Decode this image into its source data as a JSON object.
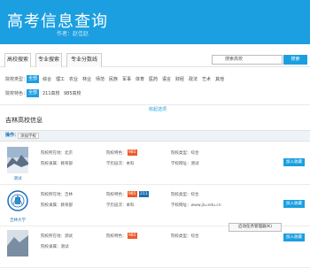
{
  "header": {
    "title": "高考信息查询",
    "author": "作者：赵佳赵"
  },
  "tabs": [
    {
      "label": "高校搜索",
      "active": true
    },
    {
      "label": "专业搜索",
      "active": false
    },
    {
      "label": "专业分数线",
      "active": false
    }
  ],
  "search": {
    "value": "搜索高校",
    "button": "搜索"
  },
  "filters": {
    "type": {
      "label": "院校类型：",
      "options": [
        "全部",
        "综合",
        "理工",
        "农业",
        "林业",
        "师范",
        "民族",
        "军事",
        "体育",
        "医药",
        "语言",
        "财经",
        "政法",
        "艺术",
        "其他"
      ],
      "selected": 0
    },
    "feature": {
      "label": "院校特色：",
      "options": [
        "全部",
        "211高校",
        "985高校"
      ],
      "selected": 0
    }
  },
  "collapse_text": "收起选项",
  "section_title": "吉林高校信息",
  "operation": {
    "label": "操作：",
    "button": "添加学校"
  },
  "universities": [
    {
      "name": "测试",
      "location": "院校所在地：北京",
      "dept": "院校隶属：教育部",
      "feature_label": "院校特色：",
      "badges": [
        "985"
      ],
      "type": "院校类型：综合",
      "level": "学历层次：本科",
      "site": "学校网址：测试",
      "add": "加入收藏"
    },
    {
      "name": "吉林大学",
      "location": "院校所在地：吉林",
      "dept": "院校隶属：教育部",
      "feature_label": "院校特色：",
      "badges": [
        "985",
        "211"
      ],
      "type": "院校类型：综合",
      "level": "学历层次：本科",
      "site": "学校网址：www.jlu.edu.cn",
      "add": "加入收藏"
    },
    {
      "name": "",
      "location": "院校所在地：测试",
      "dept": "院校隶属：测试",
      "feature_label": "院校特色：",
      "badges": [
        "985"
      ],
      "type": "院校类型：综合",
      "level": "学历层次：本科",
      "site": "学校网址：测试",
      "add": "加入收藏"
    }
  ],
  "toast": "启动任务管理器(K)",
  "colors": {
    "primary": "#1b9fe0",
    "badge985": "#f05a28",
    "badge211": "#1b6fb0"
  }
}
